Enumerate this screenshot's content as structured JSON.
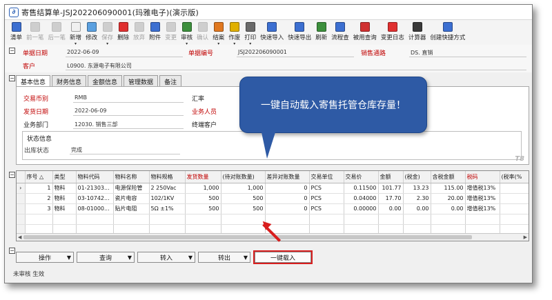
{
  "window": {
    "title": "寄售结算单-JSJ202206090001(玛雅电子)(演示版)"
  },
  "toolbar": [
    {
      "label": "清单",
      "icon": "list-icon",
      "color": "#3c6fd1",
      "enabled": true
    },
    {
      "label": "前一笔",
      "icon": "prev-icon",
      "color": "#8a8a8a",
      "enabled": false
    },
    {
      "label": "后一笔",
      "icon": "next-icon",
      "color": "#8a8a8a",
      "enabled": false
    },
    {
      "label": "新增",
      "icon": "new-doc-icon",
      "color": "#f0f0f0",
      "enabled": true,
      "dropdown": true
    },
    {
      "label": "修改",
      "icon": "edit-icon",
      "color": "#5aa0e0",
      "enabled": true
    },
    {
      "label": "保存",
      "icon": "save-icon",
      "color": "#8a8a8a",
      "enabled": false,
      "dropdown": true
    },
    {
      "label": "删除",
      "icon": "delete-icon",
      "color": "#e03030",
      "enabled": true
    },
    {
      "label": "放弃",
      "icon": "cancel-icon",
      "color": "#8a8a8a",
      "enabled": false
    },
    {
      "label": "附件",
      "icon": "attachment-icon",
      "color": "#3c6fd1",
      "enabled": true
    },
    {
      "label": "变更",
      "icon": "change-icon",
      "color": "#8a8a8a",
      "enabled": false
    },
    {
      "label": "审核",
      "icon": "approve-icon",
      "color": "#3c8f3c",
      "enabled": true,
      "dropdown": true
    },
    {
      "label": "确认",
      "icon": "confirm-icon",
      "color": "#8a8a8a",
      "enabled": false
    },
    {
      "label": "结案",
      "icon": "close-case-icon",
      "color": "#e07820",
      "enabled": true,
      "dropdown": true
    },
    {
      "label": "作废",
      "icon": "void-icon",
      "color": "#e0b000",
      "enabled": true,
      "dropdown": true
    },
    {
      "label": "打印",
      "icon": "print-icon",
      "color": "#6a6a6a",
      "enabled": true,
      "dropdown": true
    },
    {
      "label": "快速导入",
      "icon": "import-icon",
      "color": "#3c6fd1",
      "enabled": true
    },
    {
      "label": "快速导出",
      "icon": "export-icon",
      "color": "#3c6fd1",
      "enabled": true
    },
    {
      "label": "刷新",
      "icon": "refresh-icon",
      "color": "#3c8f3c",
      "enabled": true
    },
    {
      "label": "流程查",
      "icon": "flow-icon",
      "color": "#3c6fd1",
      "enabled": true
    },
    {
      "label": "被用查询",
      "icon": "usage-query-icon",
      "color": "#d03030",
      "enabled": true
    },
    {
      "label": "变更日志",
      "icon": "change-log-icon",
      "color": "#e03030",
      "enabled": true
    },
    {
      "label": "计算器",
      "icon": "calculator-icon",
      "color": "#3a3a3a",
      "enabled": true
    },
    {
      "label": "创建快捷方式",
      "icon": "shortcut-icon",
      "color": "#3c6fd1",
      "enabled": true
    }
  ],
  "header": {
    "doc_date_label": "单据日期",
    "doc_date": "2022-06-09",
    "doc_no_label": "单据编号",
    "doc_no": "JSJ202206090001",
    "sales_channel_label": "销售通路",
    "sales_channel": "DS. 直销",
    "customer_label": "客户",
    "customer": "L0900. 东源电子有限公司"
  },
  "tabs": [
    "基本信息",
    "财务信息",
    "金额信息",
    "管理数据",
    "备注"
  ],
  "basic": {
    "currency_label": "交易币别",
    "currency": "RMB",
    "rate_label": "汇率",
    "ship_date_label": "发货日期",
    "ship_date": "2022-06-09",
    "salesperson_label": "业务人员",
    "dept_label": "业务部门",
    "dept": "12030. 销售三部",
    "end_customer_label": "终端客户",
    "status_title": "状态信息",
    "out_status_label": "出库状态",
    "out_status": "完成",
    "watermark": "T8"
  },
  "callout": {
    "text": "一键自动载入寄售托管仓库存量！"
  },
  "grid": {
    "columns": [
      {
        "label": "",
        "red": false
      },
      {
        "label": "序号 △",
        "red": false
      },
      {
        "label": "类型",
        "red": false
      },
      {
        "label": "物料代码",
        "red": false
      },
      {
        "label": "物料名称",
        "red": false
      },
      {
        "label": "物料规格",
        "red": false
      },
      {
        "label": "发货数量",
        "red": true
      },
      {
        "label": "(待对账数量)",
        "red": false
      },
      {
        "label": "差异对账数量",
        "red": false
      },
      {
        "label": "交易单位",
        "red": false
      },
      {
        "label": "交易价",
        "red": false
      },
      {
        "label": "金额",
        "red": false
      },
      {
        "label": "(税金)",
        "red": false
      },
      {
        "label": "含税金额",
        "red": false
      },
      {
        "label": "税码",
        "red": true
      },
      {
        "label": "(税率(%",
        "red": false
      }
    ],
    "rows": [
      {
        "marker": "›",
        "seq": "1",
        "type": "物料",
        "code": "01-21303...",
        "name": "电源保险管",
        "spec": "2 250Vac",
        "qty": "1,000",
        "pending": "1,000",
        "diff": "0",
        "unit": "PCS",
        "price": "0.11500",
        "amount": "101.77",
        "tax": "13.23",
        "gross": "115.00",
        "taxcode": "增值税13%",
        "rate": ""
      },
      {
        "marker": "",
        "seq": "2",
        "type": "物料",
        "code": "03-10742...",
        "name": "瓷片电容",
        "spec": "102/1KV",
        "qty": "500",
        "pending": "500",
        "diff": "0",
        "unit": "PCS",
        "price": "0.04000",
        "amount": "17.70",
        "tax": "2.30",
        "gross": "20.00",
        "taxcode": "增值税13%",
        "rate": ""
      },
      {
        "marker": "",
        "seq": "3",
        "type": "物料",
        "code": "08-01000...",
        "name": "贴片电阻",
        "spec": "5Ω ±1%",
        "qty": "500",
        "pending": "500",
        "diff": "0",
        "unit": "PCS",
        "price": "0.00000",
        "amount": "0.00",
        "tax": "0.00",
        "gross": "0.00",
        "taxcode": "增值税13%",
        "rate": ""
      }
    ]
  },
  "buttons": {
    "operate": "操作",
    "query": "查询",
    "transfer_in": "转入",
    "transfer_out": "转出",
    "one_key_load": "一键载入"
  },
  "status_bar": "未审核 生效"
}
